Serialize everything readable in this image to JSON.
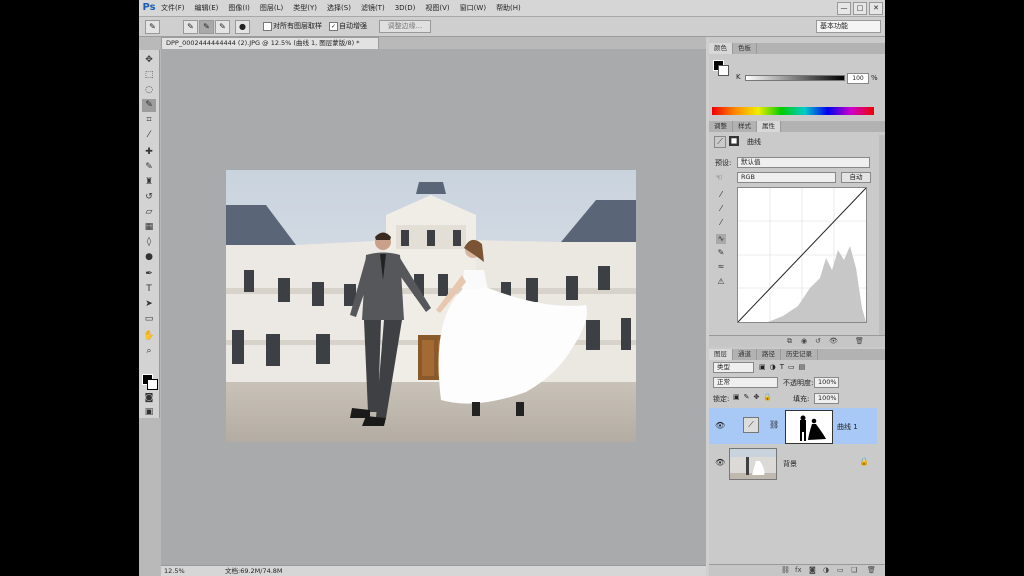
{
  "menubar": {
    "logo": "Ps",
    "items": [
      "文件(F)",
      "编辑(E)",
      "图像(I)",
      "图层(L)",
      "类型(Y)",
      "选择(S)",
      "滤镜(T)",
      "3D(D)",
      "视图(V)",
      "窗口(W)",
      "帮助(H)"
    ],
    "window_controls": [
      "—",
      "□",
      "✕"
    ]
  },
  "options": {
    "sample_all_layers": "对所有图层取样",
    "auto_enhance": "自动增强",
    "refine_edge": "调整边缘...",
    "workspace": "基本功能"
  },
  "document": {
    "tab_title": "DPP_0002444444444 (2).JPG @ 12.5% (曲线 1, 图层蒙版/8) *",
    "zoom": "12.5%",
    "doc_info": "文档:69.2M/74.8M"
  },
  "panels": {
    "color_tabs": [
      "颜色",
      "色板"
    ],
    "color_k_label": "K",
    "color_k_value": "100",
    "color_k_unit": "%",
    "adjust_tabs": [
      "调整",
      "样式",
      "属性"
    ],
    "adjust_title": "曲线",
    "preset_label": "预设:",
    "preset_value": "默认值",
    "channel_value": "RGB",
    "auto_button": "自动",
    "layer_tabs": [
      "图层",
      "通道",
      "路径",
      "历史记录"
    ],
    "kind_value": "类型",
    "blend_mode": "正常",
    "opacity_label": "不透明度:",
    "opacity_value": "100%",
    "lock_label": "锁定:",
    "fill_label": "填充:",
    "fill_value": "100%",
    "layers": [
      {
        "name": "曲线 1",
        "selected": true
      },
      {
        "name": "背景",
        "selected": false
      }
    ]
  },
  "colors": {
    "app_bg": "#b9b9b9",
    "canvas_bg": "#a9aaab",
    "layer_selected": "#a8c8f5"
  }
}
